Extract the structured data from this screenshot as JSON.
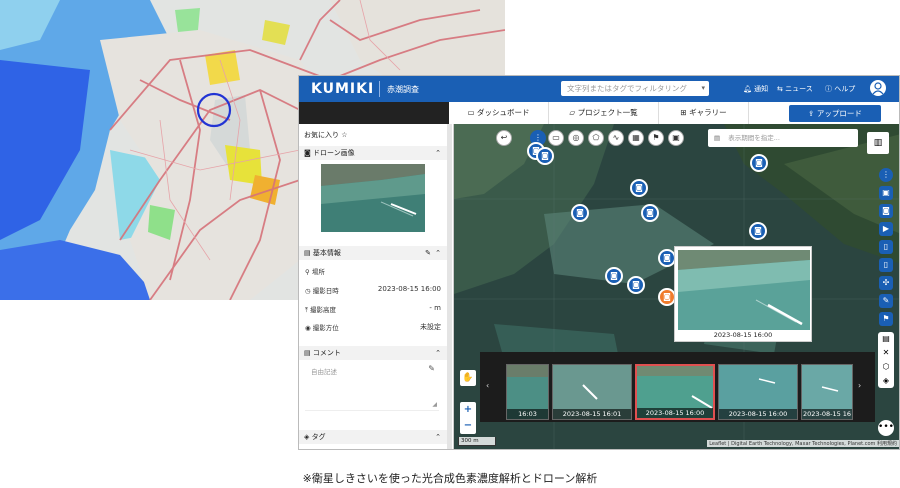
{
  "app": {
    "logo": "KUMIKI",
    "project": "赤潮調査",
    "filter_placeholder": "文字列またはタグでフィルタリング",
    "nav": [
      "通知",
      "ニュース",
      "ヘルプ"
    ]
  },
  "tabs": [
    "ダッシュボード",
    "プロジェクト一覧",
    "ギャラリー"
  ],
  "upload_label": "アップロード",
  "panel": {
    "favorites": "お気に入り",
    "drone_section": "ドローン画像",
    "basic_section": "基本情報",
    "rows": [
      {
        "label": "場所",
        "value": ""
      },
      {
        "label": "撮影日時",
        "value": "2023-08-15 16:00"
      },
      {
        "label": "撮影高度",
        "value": "- m"
      },
      {
        "label": "撮影方位",
        "value": "未設定"
      }
    ],
    "comment_section": "コメント",
    "comment_placeholder": "自由記述",
    "tag_section": "タグ"
  },
  "map": {
    "period_placeholder": "表示期間を指定...",
    "popup_time": "2023-08-15 16:00",
    "zoom_in": "+",
    "zoom_out": "−",
    "scale": "300 m",
    "attribution": "Leaflet | Digital Earth Technology, Maxar Technologies, Planet.com 利用規約",
    "strip": [
      "16:03",
      "2023-08-15 16:01",
      "2023-08-15 16:00",
      "2023-08-15 16:00",
      "2023-08-15 16"
    ]
  },
  "caption": "※衛星しきさいを使った光合成色素濃度解析とドローン解析",
  "colors": {
    "brand": "#1a5fb4",
    "highlight": "#f07b2c",
    "heat_blue": "#2255ee",
    "heat_green": "#7de27d",
    "heat_yellow": "#f3e241"
  }
}
